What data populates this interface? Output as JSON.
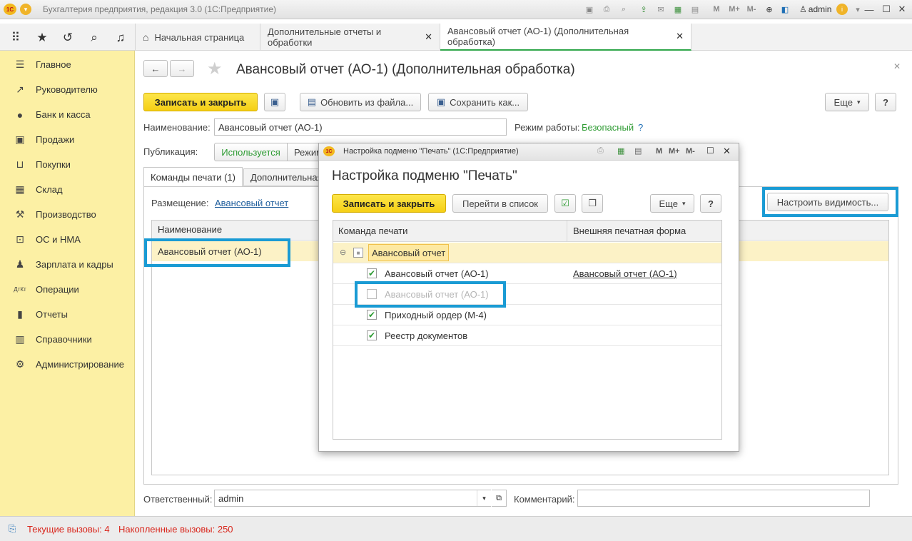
{
  "app": {
    "title": "Бухгалтерия предприятия, редакция 3.0  (1С:Предприятие)",
    "user": "admin",
    "logo": "1С",
    "toolbar_m": [
      "M",
      "M+",
      "M-"
    ]
  },
  "tabs": [
    {
      "label": "Начальная страница",
      "closable": false
    },
    {
      "label": "Дополнительные отчеты и обработки",
      "closable": true
    },
    {
      "label": "Авансовый отчет (АО-1) (Дополнительная обработка)",
      "closable": true,
      "active": true
    }
  ],
  "sidebar": {
    "items": [
      {
        "label": "Главное",
        "icon": "menu-icon"
      },
      {
        "label": "Руководителю",
        "icon": "trend-icon"
      },
      {
        "label": "Банк и касса",
        "icon": "coin-icon"
      },
      {
        "label": "Продажи",
        "icon": "cart-icon"
      },
      {
        "label": "Покупки",
        "icon": "basket-icon"
      },
      {
        "label": "Склад",
        "icon": "warehouse-icon"
      },
      {
        "label": "Производство",
        "icon": "factory-icon"
      },
      {
        "label": "ОС и НМА",
        "icon": "assets-icon"
      },
      {
        "label": "Зарплата и кадры",
        "icon": "person-icon"
      },
      {
        "label": "Операции",
        "icon": "dt-kt-icon"
      },
      {
        "label": "Отчеты",
        "icon": "bar-chart-icon"
      },
      {
        "label": "Справочники",
        "icon": "book-icon"
      },
      {
        "label": "Администрирование",
        "icon": "gear-icon"
      }
    ]
  },
  "form": {
    "title": "Авансовый отчет (АО-1) (Дополнительная обработка)",
    "save_close": "Записать и закрыть",
    "update_from_file": "Обновить из файла...",
    "save_as": "Сохранить как...",
    "more": "Еще",
    "help": "?",
    "name_label": "Наименование:",
    "name_value": "Авансовый отчет (АО-1)",
    "mode_label": "Режим работы:",
    "mode_value": "Безопасный",
    "mode_help": "?",
    "publication_label": "Публикация:",
    "publication_opt1": "Используется",
    "publication_opt2": "Режим",
    "inner_tab1": "Команды печати (1)",
    "inner_tab2": "Дополнительная",
    "placement_label": "Размещение:",
    "placement_value": "Авансовый отчет",
    "configure_visibility": "Настроить видимость...",
    "table_header": "Наименование",
    "table_row": "Авансовый отчет (АО-1)",
    "responsible_label": "Ответственный:",
    "responsible_value": "admin",
    "comment_label": "Комментарий:",
    "comment_value": ""
  },
  "status": {
    "current_calls": "Текущие вызовы: 4",
    "accumulated_calls": "Накопленные вызовы: 250"
  },
  "dialog": {
    "window_title": "Настройка подменю \"Печать\"  (1С:Предприятие)",
    "heading": "Настройка подменю \"Печать\"",
    "save_close": "Записать и закрыть",
    "goto_list": "Перейти в список",
    "more": "Еще",
    "help": "?",
    "toolbar_m": [
      "M",
      "M+",
      "M-"
    ],
    "col1": "Команда печати",
    "col2": "Внешняя печатная форма",
    "group": "Авансовый отчет",
    "rows": [
      {
        "label": "Авансовый отчет (АО-1)",
        "checked": true,
        "form": "Авансовый отчет (АО-1)"
      },
      {
        "label": "Авансовый отчет (АО-1)",
        "checked": false,
        "form": ""
      },
      {
        "label": "Приходный ордер (М-4)",
        "checked": true,
        "form": ""
      },
      {
        "label": "Реестр документов",
        "checked": true,
        "form": ""
      }
    ]
  }
}
